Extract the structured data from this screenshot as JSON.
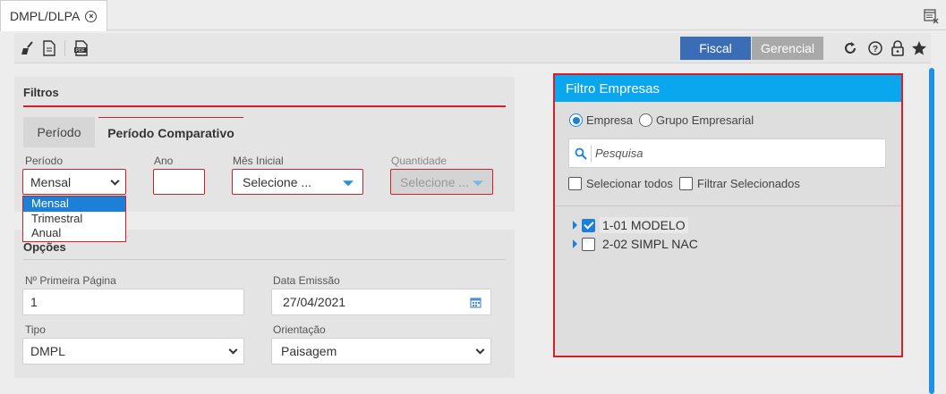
{
  "tab": {
    "title": "DMPL/DLPA"
  },
  "toolbar": {
    "icons": [
      "broom-icon",
      "document-icon",
      "pdf-icon"
    ],
    "fiscal_label": "Fiscal",
    "gerencial_label": "Gerencial",
    "right_icons": [
      "refresh-icon",
      "help-icon",
      "lock-icon",
      "star-icon"
    ]
  },
  "filtros": {
    "title": "Filtros",
    "tabs": {
      "periodo": "Período",
      "comparativo": "Período Comparativo"
    },
    "periodo": {
      "label": "Período",
      "value": "Mensal",
      "options": [
        "Mensal",
        "Trimestral",
        "Anual"
      ]
    },
    "ano": {
      "label": "Ano",
      "value": ""
    },
    "mes_inicial": {
      "label": "Mês Inicial",
      "value": "Selecione ..."
    },
    "quantidade": {
      "label": "Quantidade",
      "value": "Selecione ..."
    }
  },
  "opcoes": {
    "title": "Opções",
    "primeira_pagina": {
      "label": "Nº Primeira Página",
      "value": "1"
    },
    "data_emissao": {
      "label": "Data Emissão",
      "value": "27/04/2021"
    },
    "tipo": {
      "label": "Tipo",
      "value": "DMPL"
    },
    "orientacao": {
      "label": "Orientação",
      "value": "Paisagem"
    }
  },
  "filtro_empresas": {
    "title": "Filtro Empresas",
    "radio_empresa": "Empresa",
    "radio_grupo": "Grupo Empresarial",
    "search_placeholder": "Pesquisa",
    "selecionar_todos": "Selecionar todos",
    "filtrar_selecionados": "Filtrar Selecionados",
    "items": [
      {
        "label": "1-01 MODELO",
        "checked": true
      },
      {
        "label": "2-02 SIMPL NAC",
        "checked": false
      }
    ]
  },
  "colors": {
    "accent": "#3a6db5",
    "header": "#0aa7ef",
    "highlight": "#d4202a"
  }
}
